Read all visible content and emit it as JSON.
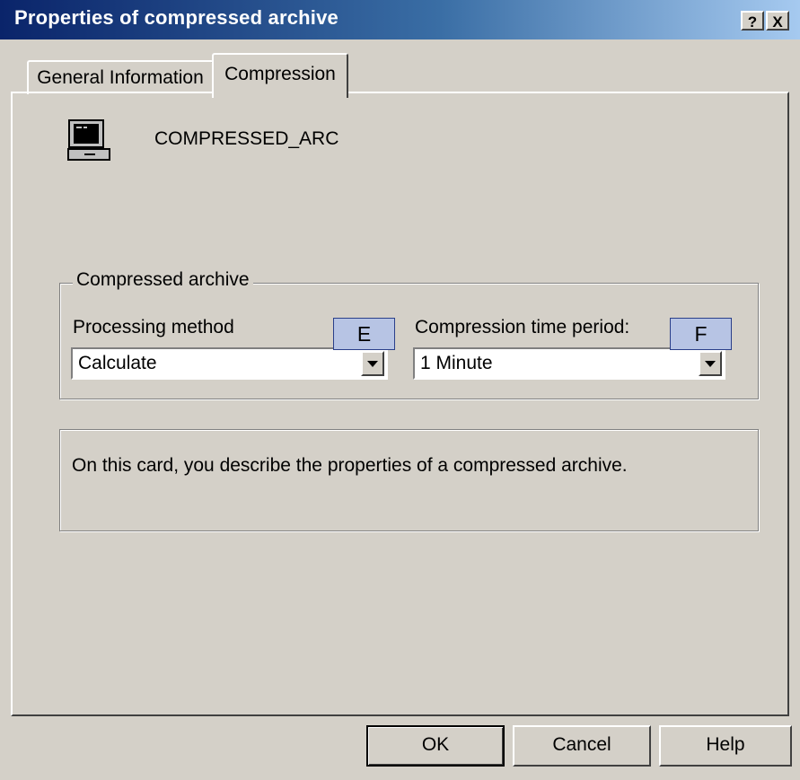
{
  "window": {
    "title": "Properties of compressed archive",
    "help_button": "?",
    "close_button": "X"
  },
  "tabs": [
    {
      "label": "General Information",
      "active": false
    },
    {
      "label": "Compression",
      "active": true
    }
  ],
  "object": {
    "name": "COMPRESSED_ARC",
    "icon": "computer-terminal-icon"
  },
  "group": {
    "title": "Compressed archive",
    "processing_method": {
      "label": "Processing method",
      "value": "Calculate",
      "callout": "E"
    },
    "compression_time": {
      "label": "Compression time period:",
      "value": "1 Minute",
      "callout": "F"
    }
  },
  "description": "On this card, you describe the properties of a compressed archive.",
  "buttons": {
    "ok": "OK",
    "cancel": "Cancel",
    "help": "Help"
  },
  "colors": {
    "titlebar_start": "#0a246a",
    "titlebar_end": "#a6caf0",
    "face": "#d4d0c8",
    "callout_fill": "#b7c4e4"
  }
}
